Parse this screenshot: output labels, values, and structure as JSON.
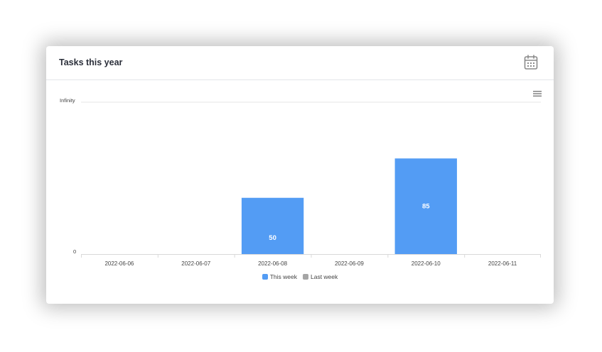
{
  "card": {
    "title": "Tasks this year",
    "calendar_icon": "calendar-icon",
    "menu_icon": "hamburger-menu-icon"
  },
  "chart_data": {
    "type": "bar",
    "categories": [
      "2022-06-06",
      "2022-06-07",
      "2022-06-08",
      "2022-06-09",
      "2022-06-10",
      "2022-06-11"
    ],
    "series": [
      {
        "name": "This week",
        "color": "#539cf4",
        "values": [
          null,
          null,
          50,
          null,
          85,
          null
        ]
      },
      {
        "name": "Last week",
        "color": "#a5a5a5",
        "values": [
          null,
          null,
          null,
          null,
          null,
          null
        ]
      }
    ],
    "y_tick_labels": [
      "0",
      "Infinity"
    ],
    "ylim": [
      0,
      135
    ],
    "grid": "horizontal",
    "legend_position": "bottom-center",
    "data_labels": true
  }
}
